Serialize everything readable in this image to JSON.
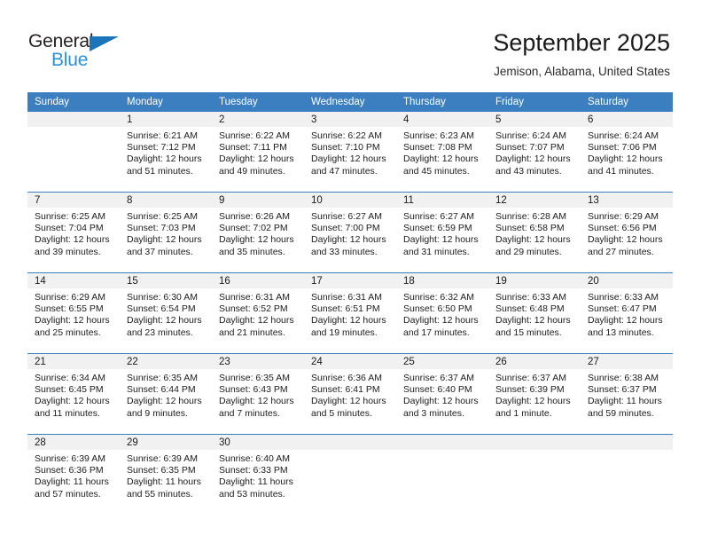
{
  "brand": {
    "name_top": "General",
    "name_bottom": "Blue",
    "color_blue": "#1b75bb",
    "color_light_blue": "#2e90d6"
  },
  "header": {
    "title": "September 2025",
    "subtitle": "Jemison, Alabama, United States"
  },
  "theme": {
    "header_bg": "#3c7fc1",
    "header_text": "#ffffff",
    "daynum_band_bg": "#f1f1f1",
    "row_divider": "#3c7fc1"
  },
  "weekday_headers": [
    "Sunday",
    "Monday",
    "Tuesday",
    "Wednesday",
    "Thursday",
    "Friday",
    "Saturday"
  ],
  "weeks": [
    [
      {
        "day": "",
        "sunrise": "",
        "sunset": "",
        "daylight_l1": "",
        "daylight_l2": ""
      },
      {
        "day": "1",
        "sunrise": "Sunrise: 6:21 AM",
        "sunset": "Sunset: 7:12 PM",
        "daylight_l1": "Daylight: 12 hours",
        "daylight_l2": "and 51 minutes."
      },
      {
        "day": "2",
        "sunrise": "Sunrise: 6:22 AM",
        "sunset": "Sunset: 7:11 PM",
        "daylight_l1": "Daylight: 12 hours",
        "daylight_l2": "and 49 minutes."
      },
      {
        "day": "3",
        "sunrise": "Sunrise: 6:22 AM",
        "sunset": "Sunset: 7:10 PM",
        "daylight_l1": "Daylight: 12 hours",
        "daylight_l2": "and 47 minutes."
      },
      {
        "day": "4",
        "sunrise": "Sunrise: 6:23 AM",
        "sunset": "Sunset: 7:08 PM",
        "daylight_l1": "Daylight: 12 hours",
        "daylight_l2": "and 45 minutes."
      },
      {
        "day": "5",
        "sunrise": "Sunrise: 6:24 AM",
        "sunset": "Sunset: 7:07 PM",
        "daylight_l1": "Daylight: 12 hours",
        "daylight_l2": "and 43 minutes."
      },
      {
        "day": "6",
        "sunrise": "Sunrise: 6:24 AM",
        "sunset": "Sunset: 7:06 PM",
        "daylight_l1": "Daylight: 12 hours",
        "daylight_l2": "and 41 minutes."
      }
    ],
    [
      {
        "day": "7",
        "sunrise": "Sunrise: 6:25 AM",
        "sunset": "Sunset: 7:04 PM",
        "daylight_l1": "Daylight: 12 hours",
        "daylight_l2": "and 39 minutes."
      },
      {
        "day": "8",
        "sunrise": "Sunrise: 6:25 AM",
        "sunset": "Sunset: 7:03 PM",
        "daylight_l1": "Daylight: 12 hours",
        "daylight_l2": "and 37 minutes."
      },
      {
        "day": "9",
        "sunrise": "Sunrise: 6:26 AM",
        "sunset": "Sunset: 7:02 PM",
        "daylight_l1": "Daylight: 12 hours",
        "daylight_l2": "and 35 minutes."
      },
      {
        "day": "10",
        "sunrise": "Sunrise: 6:27 AM",
        "sunset": "Sunset: 7:00 PM",
        "daylight_l1": "Daylight: 12 hours",
        "daylight_l2": "and 33 minutes."
      },
      {
        "day": "11",
        "sunrise": "Sunrise: 6:27 AM",
        "sunset": "Sunset: 6:59 PM",
        "daylight_l1": "Daylight: 12 hours",
        "daylight_l2": "and 31 minutes."
      },
      {
        "day": "12",
        "sunrise": "Sunrise: 6:28 AM",
        "sunset": "Sunset: 6:58 PM",
        "daylight_l1": "Daylight: 12 hours",
        "daylight_l2": "and 29 minutes."
      },
      {
        "day": "13",
        "sunrise": "Sunrise: 6:29 AM",
        "sunset": "Sunset: 6:56 PM",
        "daylight_l1": "Daylight: 12 hours",
        "daylight_l2": "and 27 minutes."
      }
    ],
    [
      {
        "day": "14",
        "sunrise": "Sunrise: 6:29 AM",
        "sunset": "Sunset: 6:55 PM",
        "daylight_l1": "Daylight: 12 hours",
        "daylight_l2": "and 25 minutes."
      },
      {
        "day": "15",
        "sunrise": "Sunrise: 6:30 AM",
        "sunset": "Sunset: 6:54 PM",
        "daylight_l1": "Daylight: 12 hours",
        "daylight_l2": "and 23 minutes."
      },
      {
        "day": "16",
        "sunrise": "Sunrise: 6:31 AM",
        "sunset": "Sunset: 6:52 PM",
        "daylight_l1": "Daylight: 12 hours",
        "daylight_l2": "and 21 minutes."
      },
      {
        "day": "17",
        "sunrise": "Sunrise: 6:31 AM",
        "sunset": "Sunset: 6:51 PM",
        "daylight_l1": "Daylight: 12 hours",
        "daylight_l2": "and 19 minutes."
      },
      {
        "day": "18",
        "sunrise": "Sunrise: 6:32 AM",
        "sunset": "Sunset: 6:50 PM",
        "daylight_l1": "Daylight: 12 hours",
        "daylight_l2": "and 17 minutes."
      },
      {
        "day": "19",
        "sunrise": "Sunrise: 6:33 AM",
        "sunset": "Sunset: 6:48 PM",
        "daylight_l1": "Daylight: 12 hours",
        "daylight_l2": "and 15 minutes."
      },
      {
        "day": "20",
        "sunrise": "Sunrise: 6:33 AM",
        "sunset": "Sunset: 6:47 PM",
        "daylight_l1": "Daylight: 12 hours",
        "daylight_l2": "and 13 minutes."
      }
    ],
    [
      {
        "day": "21",
        "sunrise": "Sunrise: 6:34 AM",
        "sunset": "Sunset: 6:45 PM",
        "daylight_l1": "Daylight: 12 hours",
        "daylight_l2": "and 11 minutes."
      },
      {
        "day": "22",
        "sunrise": "Sunrise: 6:35 AM",
        "sunset": "Sunset: 6:44 PM",
        "daylight_l1": "Daylight: 12 hours",
        "daylight_l2": "and 9 minutes."
      },
      {
        "day": "23",
        "sunrise": "Sunrise: 6:35 AM",
        "sunset": "Sunset: 6:43 PM",
        "daylight_l1": "Daylight: 12 hours",
        "daylight_l2": "and 7 minutes."
      },
      {
        "day": "24",
        "sunrise": "Sunrise: 6:36 AM",
        "sunset": "Sunset: 6:41 PM",
        "daylight_l1": "Daylight: 12 hours",
        "daylight_l2": "and 5 minutes."
      },
      {
        "day": "25",
        "sunrise": "Sunrise: 6:37 AM",
        "sunset": "Sunset: 6:40 PM",
        "daylight_l1": "Daylight: 12 hours",
        "daylight_l2": "and 3 minutes."
      },
      {
        "day": "26",
        "sunrise": "Sunrise: 6:37 AM",
        "sunset": "Sunset: 6:39 PM",
        "daylight_l1": "Daylight: 12 hours",
        "daylight_l2": "and 1 minute."
      },
      {
        "day": "27",
        "sunrise": "Sunrise: 6:38 AM",
        "sunset": "Sunset: 6:37 PM",
        "daylight_l1": "Daylight: 11 hours",
        "daylight_l2": "and 59 minutes."
      }
    ],
    [
      {
        "day": "28",
        "sunrise": "Sunrise: 6:39 AM",
        "sunset": "Sunset: 6:36 PM",
        "daylight_l1": "Daylight: 11 hours",
        "daylight_l2": "and 57 minutes."
      },
      {
        "day": "29",
        "sunrise": "Sunrise: 6:39 AM",
        "sunset": "Sunset: 6:35 PM",
        "daylight_l1": "Daylight: 11 hours",
        "daylight_l2": "and 55 minutes."
      },
      {
        "day": "30",
        "sunrise": "Sunrise: 6:40 AM",
        "sunset": "Sunset: 6:33 PM",
        "daylight_l1": "Daylight: 11 hours",
        "daylight_l2": "and 53 minutes."
      },
      {
        "day": "",
        "sunrise": "",
        "sunset": "",
        "daylight_l1": "",
        "daylight_l2": ""
      },
      {
        "day": "",
        "sunrise": "",
        "sunset": "",
        "daylight_l1": "",
        "daylight_l2": ""
      },
      {
        "day": "",
        "sunrise": "",
        "sunset": "",
        "daylight_l1": "",
        "daylight_l2": ""
      },
      {
        "day": "",
        "sunrise": "",
        "sunset": "",
        "daylight_l1": "",
        "daylight_l2": ""
      }
    ]
  ]
}
